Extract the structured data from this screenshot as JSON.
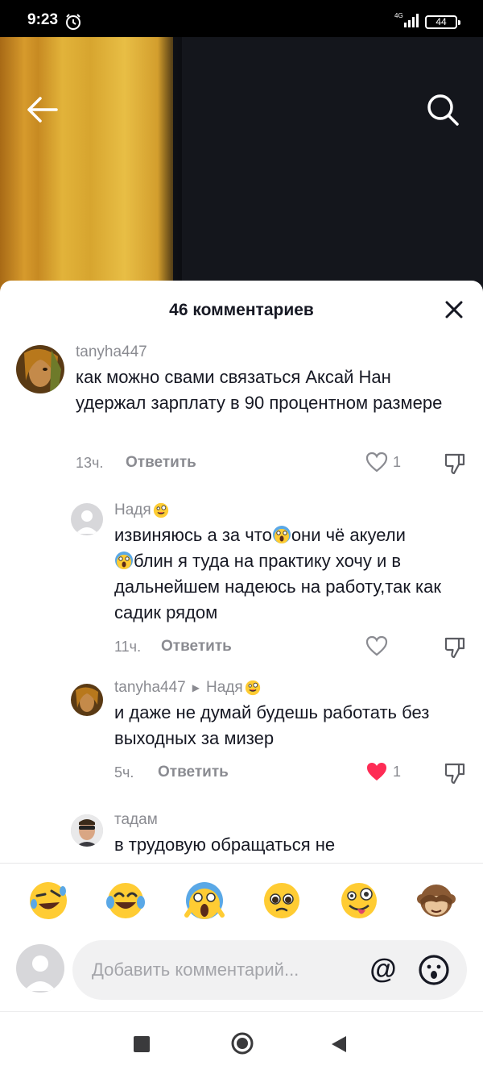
{
  "status": {
    "time": "9:23",
    "network": "4G",
    "battery": "44"
  },
  "header": {
    "back_icon": "arrow-left-icon",
    "search_icon": "search-icon"
  },
  "sheet": {
    "title": "46 комментариев",
    "close_icon": "close-icon"
  },
  "comments": [
    {
      "user": "tanyha447",
      "text": "как можно свами связаться Аксай Нан удержал зарплату в 90 процентном размере",
      "time": "13ч.",
      "reply_label": "Ответить",
      "likes": "1",
      "liked": false
    },
    {
      "user": "Надя",
      "text_part1": "извиняюсь а за что",
      "text_part2": "они чё акуели",
      "text_part3": "блин я туда на практику хочу и в дальнейшем надеюсь на работу,так как садик рядом",
      "time": "11ч.",
      "reply_label": "Ответить",
      "likes": "",
      "liked": false
    },
    {
      "user": "tanyha447",
      "reply_to": "Надя",
      "text": "и даже не думай будешь работать без выходных за мизер",
      "time": "5ч.",
      "reply_label": "Ответить",
      "likes": "1",
      "liked": true
    },
    {
      "user": "тадам",
      "text": "в трудовую обращаться не"
    }
  ],
  "quick_emojis": [
    "rolling-laugh-emoji",
    "tears-of-joy-emoji",
    "screaming-face-emoji",
    "pleading-face-emoji",
    "zany-face-emoji",
    "see-no-evil-monkey-emoji"
  ],
  "input": {
    "placeholder": "Добавить комментарий...",
    "at_label": "@"
  },
  "colors": {
    "like_active": "#fe2c55",
    "text_primary": "#161823",
    "text_secondary": "#8a8b91"
  }
}
